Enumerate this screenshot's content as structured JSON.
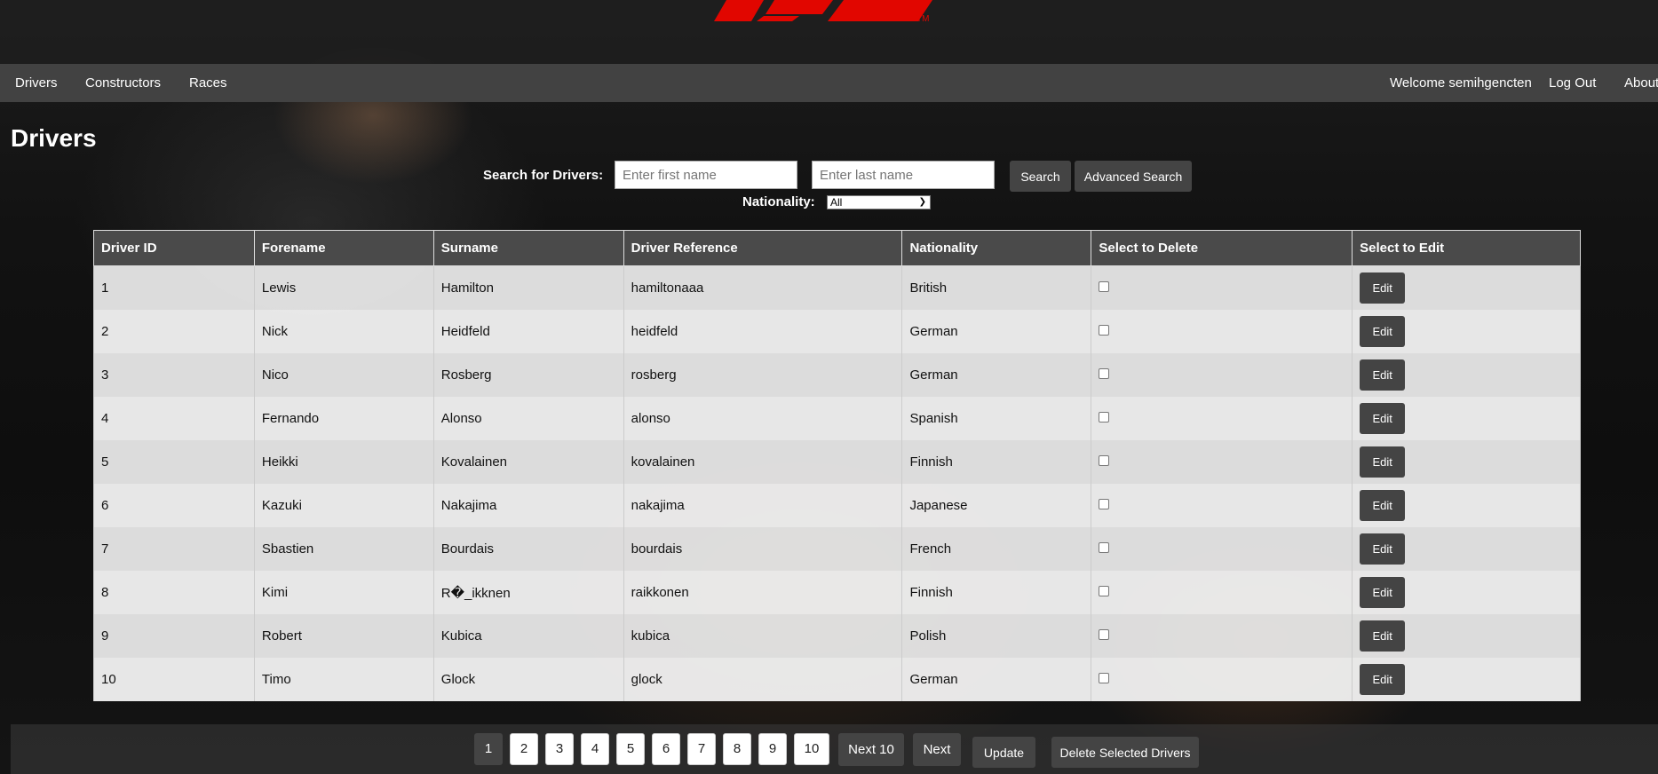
{
  "nav": {
    "links": [
      "Drivers",
      "Constructors",
      "Races"
    ],
    "welcome": "Welcome semihgencten",
    "logout": "Log Out",
    "about": "About"
  },
  "page_title": "Drivers",
  "search": {
    "label": "Search for Drivers:",
    "first_placeholder": "Enter first name",
    "last_placeholder": "Enter last name",
    "search_button": "Search",
    "advanced_button": "Advanced Search",
    "nationality_label": "Nationality:",
    "nationality_value": "All"
  },
  "table": {
    "headers": [
      "Driver ID",
      "Forename",
      "Surname",
      "Driver Reference",
      "Nationality",
      "Select to Delete",
      "Select to Edit"
    ],
    "edit_label": "Edit",
    "rows": [
      [
        "1",
        "Lewis",
        "Hamilton",
        "hamiltonaaa",
        "British"
      ],
      [
        "2",
        "Nick",
        "Heidfeld",
        "heidfeld",
        "German"
      ],
      [
        "3",
        "Nico",
        "Rosberg",
        "rosberg",
        "German"
      ],
      [
        "4",
        "Fernando",
        "Alonso",
        "alonso",
        "Spanish"
      ],
      [
        "5",
        "Heikki",
        "Kovalainen",
        "kovalainen",
        "Finnish"
      ],
      [
        "6",
        "Kazuki",
        "Nakajima",
        "nakajima",
        "Japanese"
      ],
      [
        "7",
        "Sbastien",
        "Bourdais",
        "bourdais",
        "French"
      ],
      [
        "8",
        "Kimi",
        "R�_ikknen",
        "raikkonen",
        "Finnish"
      ],
      [
        "9",
        "Robert",
        "Kubica",
        "kubica",
        "Polish"
      ],
      [
        "10",
        "Timo",
        "Glock",
        "glock",
        "German"
      ]
    ]
  },
  "pagination": {
    "pages": [
      "1",
      "2",
      "3",
      "4",
      "5",
      "6",
      "7",
      "8",
      "9",
      "10"
    ],
    "active_page": "1",
    "next10": "Next 10",
    "next": "Next",
    "update": "Update",
    "delete_selected": "Delete Selected Drivers"
  },
  "colors": {
    "brand_red": "#e10600",
    "nav_bg": "#424242",
    "button_bg": "#444444"
  },
  "logo": {
    "text": "F1",
    "trademark": "TM"
  }
}
